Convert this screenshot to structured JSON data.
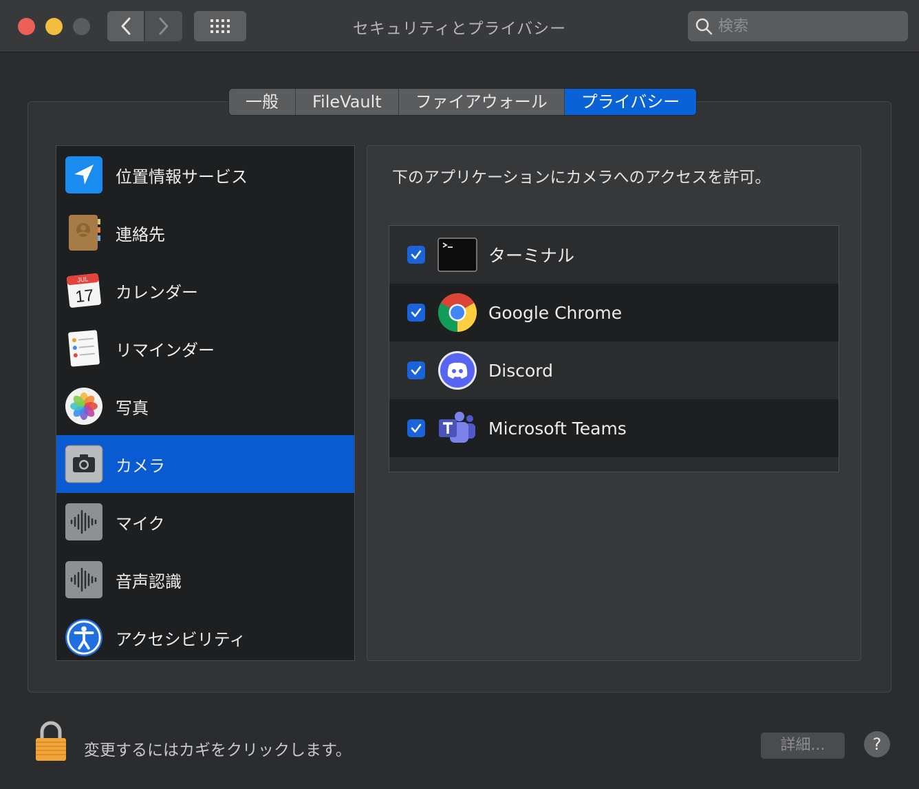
{
  "window": {
    "title": "セキュリティとプライバシー"
  },
  "search": {
    "placeholder": "検索"
  },
  "tabs": [
    {
      "label": "一般"
    },
    {
      "label": "FileVault"
    },
    {
      "label": "ファイアウォール"
    },
    {
      "label": "プライバシー",
      "active": true
    }
  ],
  "sidebar": {
    "items": [
      {
        "label": "位置情報サービス",
        "icon": "location-arrow-icon"
      },
      {
        "label": "連絡先",
        "icon": "contacts-book-icon"
      },
      {
        "label": "カレンダー",
        "icon": "calendar-icon",
        "calendar_month": "JUL",
        "calendar_day": "17"
      },
      {
        "label": "リマインダー",
        "icon": "reminders-icon"
      },
      {
        "label": "写真",
        "icon": "photos-icon"
      },
      {
        "label": "カメラ",
        "icon": "camera-icon",
        "selected": true
      },
      {
        "label": "マイク",
        "icon": "microphone-waveform-icon"
      },
      {
        "label": "音声認識",
        "icon": "speech-recognition-icon"
      },
      {
        "label": "アクセシビリティ",
        "icon": "accessibility-icon"
      }
    ]
  },
  "main": {
    "description": "下のアプリケーションにカメラへのアクセスを許可。",
    "apps": [
      {
        "name": "ターミナル",
        "checked": true,
        "icon": "terminal-icon"
      },
      {
        "name": "Google Chrome",
        "checked": true,
        "icon": "chrome-icon"
      },
      {
        "name": "Discord",
        "checked": true,
        "icon": "discord-icon"
      },
      {
        "name": "Microsoft Teams",
        "checked": true,
        "icon": "teams-icon"
      }
    ]
  },
  "footer": {
    "lock_text": "変更するにはカギをクリックします。",
    "details_label": "詳細...",
    "help_label": "?"
  },
  "colors": {
    "accent": "#0a62d9",
    "selection": "#0a5ad1",
    "checkbox": "#1b63d9"
  }
}
